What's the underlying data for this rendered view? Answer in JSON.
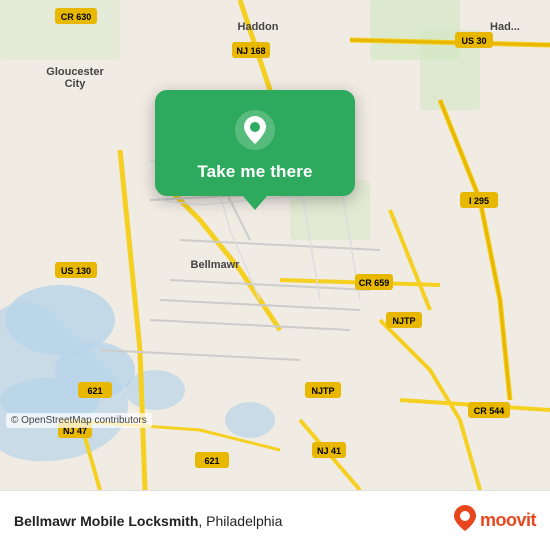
{
  "map": {
    "background_color": "#e8e0d8",
    "copyright": "© OpenStreetMap contributors"
  },
  "popup": {
    "label": "Take me there",
    "pin_icon": "location-pin-icon"
  },
  "footer": {
    "business_name": "Bellmawr Mobile Locksmith",
    "city": "Philadelphia",
    "full_text": "Bellmawr Mobile Locksmith, Philadelphia",
    "logo_text": "moovit",
    "logo_pin": "📍"
  }
}
